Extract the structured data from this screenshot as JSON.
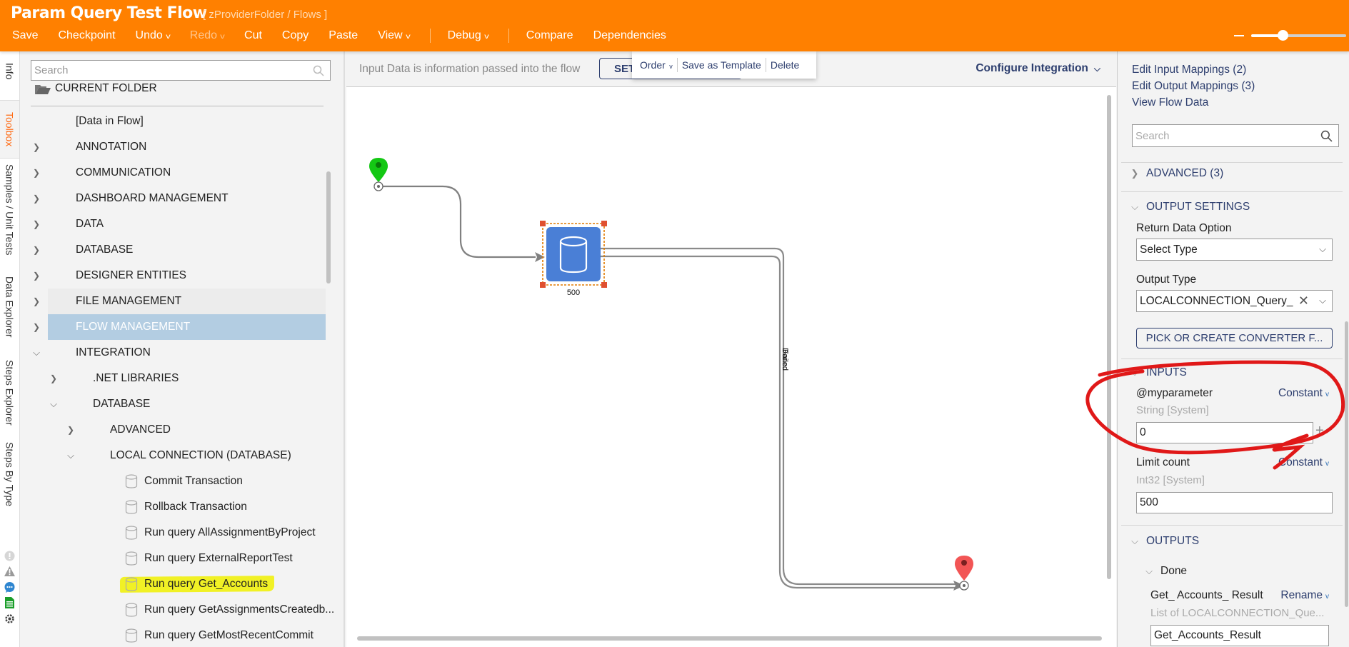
{
  "header": {
    "title": "Param Query Test Flow",
    "path": "[ zProviderFolder / Flows ]"
  },
  "toolbar": {
    "save": "Save",
    "checkpoint": "Checkpoint",
    "undo": "Undo",
    "redo": "Redo",
    "cut": "Cut",
    "copy": "Copy",
    "paste": "Paste",
    "view": "View",
    "debug": "Debug",
    "compare": "Compare",
    "dependencies": "Dependencies",
    "chevron": "⌄",
    "zoom_level_fraction": 0.35
  },
  "vertical_tabs": [
    {
      "label": "Info"
    },
    {
      "label": "Toolbox",
      "active": true
    },
    {
      "label": "Samples / Unit Tests"
    },
    {
      "label": "Data Explorer"
    },
    {
      "label": "Steps Explorer"
    },
    {
      "label": "Steps By Type"
    }
  ],
  "side_icons": [
    "error-icon",
    "warning-icon",
    "comment-icon",
    "document-icon",
    "settings-tools-icon"
  ],
  "toolbox": {
    "search_placeholder": "Search",
    "current_folder": "CURRENT FOLDER",
    "items": [
      {
        "label": "[Data in Flow]",
        "level": 0,
        "arrow": ""
      },
      {
        "label": "ANNOTATION",
        "level": 0,
        "arrow": "›"
      },
      {
        "label": "COMMUNICATION",
        "level": 0,
        "arrow": "›"
      },
      {
        "label": "DASHBOARD MANAGEMENT",
        "level": 0,
        "arrow": "›"
      },
      {
        "label": "DATA",
        "level": 0,
        "arrow": "›"
      },
      {
        "label": "DATABASE",
        "level": 0,
        "arrow": "›"
      },
      {
        "label": "DESIGNER ENTITIES",
        "level": 0,
        "arrow": "›"
      },
      {
        "label": "FILE MANAGEMENT",
        "level": 0,
        "arrow": "›"
      },
      {
        "label": "FLOW MANAGEMENT",
        "level": 0,
        "arrow": "›"
      },
      {
        "label": "INTEGRATION",
        "level": 0,
        "arrow": "⌄"
      },
      {
        "label": ".NET LIBRARIES",
        "level": 1,
        "arrow": "›"
      },
      {
        "label": "DATABASE",
        "level": 1,
        "arrow": "⌄"
      },
      {
        "label": "ADVANCED",
        "level": 2,
        "arrow": "›"
      },
      {
        "label": "LOCAL CONNECTION (DATABASE)",
        "level": 2,
        "arrow": "⌄"
      },
      {
        "label": "Commit Transaction",
        "level": 3,
        "step": true
      },
      {
        "label": "Rollback Transaction",
        "level": 3,
        "step": true
      },
      {
        "label": "Run query AllAssignmentByProject",
        "level": 3,
        "step": true
      },
      {
        "label": "Run query ExternalReportTest",
        "level": 3,
        "step": true
      },
      {
        "label": "Run query Get_Accounts",
        "level": 3,
        "step": true,
        "highlighted": true
      },
      {
        "label": "Run query GetAssignmentsCreatedb...",
        "level": 3,
        "step": true
      },
      {
        "label": "Run query GetMostRecentCommit",
        "level": 3,
        "step": true
      }
    ]
  },
  "canvas": {
    "input_info": "Input Data is information passed into the flow",
    "set_button": "SET",
    "configure": "Configure Integration",
    "popup": {
      "order": "Order",
      "save_as_template": "Save as Template",
      "delete": "Delete"
    },
    "step_label": "500",
    "path_labels": [
      "Done",
      "Failed"
    ],
    "colors": {
      "start": "#14c814",
      "end": "#f25555",
      "step": "#4a7fd6",
      "selection": "#e07a00",
      "handle": "#e05030",
      "connector": "#808080"
    }
  },
  "right_panel": {
    "links": [
      "Edit Input Mappings (2)",
      "Edit Output Mappings (3)",
      "View Flow Data"
    ],
    "search_placeholder": "Search",
    "advanced": "ADVANCED (3)",
    "output_settings": {
      "title": "OUTPUT SETTINGS",
      "return_label": "Return Data Option",
      "return_value": "Select Type",
      "output_type_label": "Output Type",
      "output_type_value": "LOCALCONNECTION_Query_",
      "converter_button": "PICK OR CREATE CONVERTER F..."
    },
    "inputs": {
      "title": "INPUTS",
      "params": [
        {
          "name": "@myparameter",
          "mode": "Constant",
          "type": "String [System]",
          "value": "0"
        },
        {
          "name": "Limit count",
          "mode": "Constant",
          "type": "Int32 [System]",
          "value": "500"
        }
      ]
    },
    "outputs": {
      "title": "OUTPUTS",
      "path": "Done",
      "result_name": "Get_ Accounts_ Result",
      "result_mode": "Rename",
      "result_type": "List of LOCALCONNECTION_Que...",
      "result_value": "Get_Accounts_Result"
    }
  }
}
